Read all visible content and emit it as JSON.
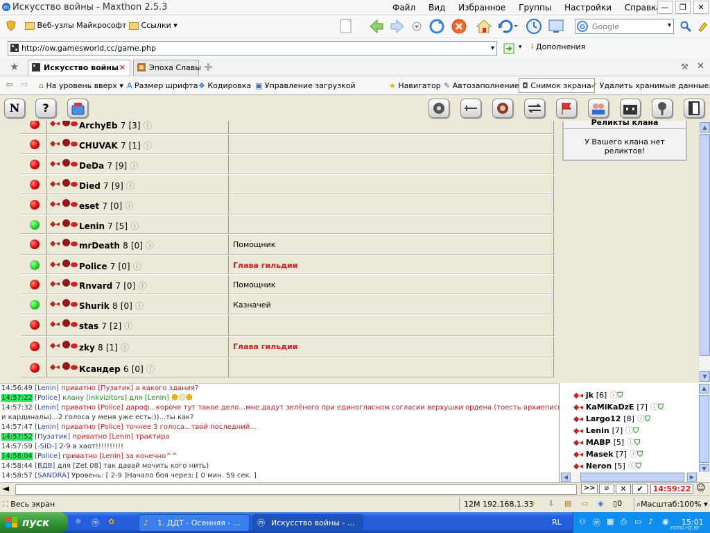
{
  "window": {
    "title": "Искусство войны - Maxthon 2.5.3",
    "menu": [
      "Файл",
      "Вид",
      "Избранное",
      "Группы",
      "Настройки",
      "Справка"
    ]
  },
  "links": {
    "favorites": [
      "Веб-узлы Майкрософт",
      "Ссылки"
    ],
    "search_placeholder": "Google"
  },
  "address": {
    "url": "http://ow.gamesworld.cc/game.php",
    "addons": "Дополнения"
  },
  "tabs": [
    {
      "label": "Искусство войны",
      "active": true
    },
    {
      "label": "Эпоха Славы",
      "active": false
    }
  ],
  "tools": {
    "items": [
      "На уровень вверх",
      "Размер шрифта",
      "Кодировка",
      "Управление загрузкой",
      "Навигатор",
      "Автозаполнение",
      "Снимок экрана",
      "Удалить хранимые данные..."
    ]
  },
  "game_toolbar": {
    "left": [
      "N",
      "?"
    ]
  },
  "members": [
    {
      "name": "ArchyEb",
      "level": "7",
      "count": "[3]",
      "online": false,
      "role": ""
    },
    {
      "name": "CHUVAK",
      "level": "7",
      "count": "[1]",
      "online": false,
      "role": ""
    },
    {
      "name": "DeDa",
      "level": "7",
      "count": "[9]",
      "online": false,
      "role": ""
    },
    {
      "name": "Died",
      "level": "7",
      "count": "[9]",
      "online": false,
      "role": ""
    },
    {
      "name": "eset",
      "level": "7",
      "count": "[0]",
      "online": false,
      "role": ""
    },
    {
      "name": "Lenin",
      "level": "7",
      "count": "[5]",
      "online": true,
      "role": ""
    },
    {
      "name": "mrDeath",
      "level": "8",
      "count": "[0]",
      "online": false,
      "role": "Помощник"
    },
    {
      "name": "Police",
      "level": "7",
      "count": "[0]",
      "online": true,
      "role": "Глава гильдии"
    },
    {
      "name": "Rnvard",
      "level": "7",
      "count": "[0]",
      "online": false,
      "role": "Помощник"
    },
    {
      "name": "Shurik",
      "level": "8",
      "count": "[0]",
      "online": true,
      "role": "Казначей"
    },
    {
      "name": "stas",
      "level": "7",
      "count": "[2]",
      "online": false,
      "role": ""
    },
    {
      "name": "zky",
      "level": "8",
      "count": "[1]",
      "online": false,
      "role": "Глава гильдии"
    },
    {
      "name": "Ксандер",
      "level": "6",
      "count": "[0]",
      "online": false,
      "role": ""
    }
  ],
  "relics": {
    "title": "Реликты клана",
    "text": "У Вашего клана нет реликтов!"
  },
  "chat": [
    {
      "time": "14:56:49",
      "who": "[Lenin]",
      "kind": "приватно",
      "target": "[Пузатик]",
      "text": "а какого здания?"
    },
    {
      "time": "14:57:22",
      "who": "[Police]",
      "kind": "клану",
      "target": "[inkvizitors]",
      "text": "для [Lenin]"
    },
    {
      "time": "14:57:32",
      "who": "[Lenin]",
      "kind": "приватно",
      "target": "[Police]",
      "text": "дароф...короче тут такое дело...мне дадут зелёного при единогласном согласии верхушки ордена (тоесть архиепископ"
    },
    {
      "time": "",
      "who": "",
      "kind": "",
      "target": "",
      "text": "и кардиналы)...2 голоса у меня уже есть:))...ты как?"
    },
    {
      "time": "14:57:47",
      "who": "[Lenin]",
      "kind": "приватно",
      "target": "[Police]",
      "text": "точнее 3 голоса...твой последний..."
    },
    {
      "time": "14:57:52",
      "who": "[Пузатик]",
      "kind": "приватно",
      "target": "[Lenin]",
      "text": "трактира"
    },
    {
      "time": "14:57:59",
      "who": "[-SID-]",
      "kind": "",
      "target": "",
      "text": "2-9 в хаот!!!!!!!!!!"
    },
    {
      "time": "14:58:04",
      "who": "[Police]",
      "kind": "приватно",
      "target": "[Lenin]",
      "text": "за конечно^^"
    },
    {
      "time": "14:58:44",
      "who": "[ВДВ]",
      "kind": "для",
      "target": "[Zet 08]",
      "text": "так давай мочить кого нить)"
    },
    {
      "time": "14:58:57",
      "who": "[SANDRA]",
      "kind": "",
      "target": "",
      "text": "Уровень: [ 2-9 ]Начало боя через: [ 0 мин. 59 сек. ]"
    }
  ],
  "online": [
    {
      "name": "jk",
      "level": "[6]"
    },
    {
      "name": "KaMiKaDzE",
      "level": "[7]"
    },
    {
      "name": "Largo12",
      "level": "[8]"
    },
    {
      "name": "Lenin",
      "level": "[7]"
    },
    {
      "name": "МАВР",
      "level": "[5]"
    },
    {
      "name": "Masek",
      "level": "[7]"
    },
    {
      "name": "Neron",
      "level": "[5]"
    }
  ],
  "input": {
    "clock": "14:59:22"
  },
  "status": {
    "left": "Весь экран",
    "memory": "12M 192.168.1.33",
    "count": "0",
    "zoom": "Масштаб:100%"
  },
  "taskbar": {
    "start": "пуск",
    "tasks": [
      "1. ДДТ - Осенняя - ...",
      "Искусство войны - ..."
    ],
    "lang": "RL",
    "time": "15:01",
    "watermark": "FOTO.HZ.BY"
  },
  "colors": {
    "leader": "#d61c1c",
    "online": "#1ec81e",
    "offline": "#d00000",
    "highlight": "#2ee85e"
  }
}
